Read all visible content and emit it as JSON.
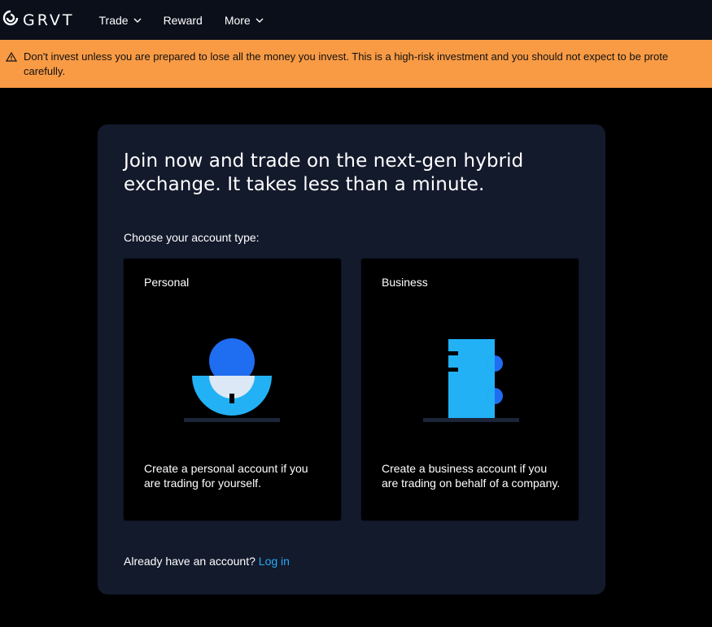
{
  "nav": {
    "logo_text": "GRVT",
    "items": [
      {
        "label": "Trade",
        "has_dropdown": true
      },
      {
        "label": "Reward",
        "has_dropdown": false
      },
      {
        "label": "More",
        "has_dropdown": true
      }
    ]
  },
  "warning": {
    "line1": "Don't invest unless you are prepared to lose all the money you invest. This is a high-risk investment and you should not expect to be prote",
    "line2": "carefully."
  },
  "signup": {
    "title": "Join now and trade on the next-gen hybrid exchange. It takes less than a minute.",
    "choose_label": "Choose your account type:",
    "personal": {
      "name": "Personal",
      "description": "Create a personal account if you are trading for yourself."
    },
    "business": {
      "name": "Business",
      "description": "Create a business account if you are trading on behalf of a company."
    },
    "login_prompt": "Already have an account?",
    "login_link": "Log in"
  },
  "colors": {
    "page_bg": "#000000",
    "nav_bg": "#0b0f1a",
    "warning_bg": "#f99b45",
    "card_bg": "#131a2c",
    "accent_blue": "#1f6df0",
    "accent_light_blue": "#22b1f5",
    "link": "#29a9f5"
  },
  "icons": [
    "grvt-logo-icon",
    "chevron-down-icon",
    "warning-triangle-icon",
    "personal-illustration-icon",
    "business-illustration-icon"
  ]
}
